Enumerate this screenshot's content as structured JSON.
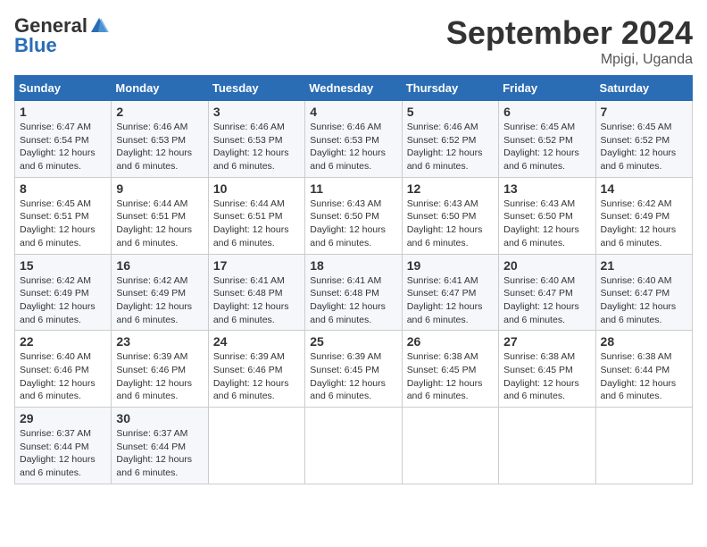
{
  "logo": {
    "general": "General",
    "blue": "Blue"
  },
  "header": {
    "month": "September 2024",
    "location": "Mpigi, Uganda"
  },
  "days_of_week": [
    "Sunday",
    "Monday",
    "Tuesday",
    "Wednesday",
    "Thursday",
    "Friday",
    "Saturday"
  ],
  "weeks": [
    [
      {
        "day": "1",
        "sunrise": "6:47 AM",
        "sunset": "6:54 PM",
        "daylight": "12 hours and 6 minutes."
      },
      {
        "day": "2",
        "sunrise": "6:46 AM",
        "sunset": "6:53 PM",
        "daylight": "12 hours and 6 minutes."
      },
      {
        "day": "3",
        "sunrise": "6:46 AM",
        "sunset": "6:53 PM",
        "daylight": "12 hours and 6 minutes."
      },
      {
        "day": "4",
        "sunrise": "6:46 AM",
        "sunset": "6:53 PM",
        "daylight": "12 hours and 6 minutes."
      },
      {
        "day": "5",
        "sunrise": "6:46 AM",
        "sunset": "6:52 PM",
        "daylight": "12 hours and 6 minutes."
      },
      {
        "day": "6",
        "sunrise": "6:45 AM",
        "sunset": "6:52 PM",
        "daylight": "12 hours and 6 minutes."
      },
      {
        "day": "7",
        "sunrise": "6:45 AM",
        "sunset": "6:52 PM",
        "daylight": "12 hours and 6 minutes."
      }
    ],
    [
      {
        "day": "8",
        "sunrise": "6:45 AM",
        "sunset": "6:51 PM",
        "daylight": "12 hours and 6 minutes."
      },
      {
        "day": "9",
        "sunrise": "6:44 AM",
        "sunset": "6:51 PM",
        "daylight": "12 hours and 6 minutes."
      },
      {
        "day": "10",
        "sunrise": "6:44 AM",
        "sunset": "6:51 PM",
        "daylight": "12 hours and 6 minutes."
      },
      {
        "day": "11",
        "sunrise": "6:43 AM",
        "sunset": "6:50 PM",
        "daylight": "12 hours and 6 minutes."
      },
      {
        "day": "12",
        "sunrise": "6:43 AM",
        "sunset": "6:50 PM",
        "daylight": "12 hours and 6 minutes."
      },
      {
        "day": "13",
        "sunrise": "6:43 AM",
        "sunset": "6:50 PM",
        "daylight": "12 hours and 6 minutes."
      },
      {
        "day": "14",
        "sunrise": "6:42 AM",
        "sunset": "6:49 PM",
        "daylight": "12 hours and 6 minutes."
      }
    ],
    [
      {
        "day": "15",
        "sunrise": "6:42 AM",
        "sunset": "6:49 PM",
        "daylight": "12 hours and 6 minutes."
      },
      {
        "day": "16",
        "sunrise": "6:42 AM",
        "sunset": "6:49 PM",
        "daylight": "12 hours and 6 minutes."
      },
      {
        "day": "17",
        "sunrise": "6:41 AM",
        "sunset": "6:48 PM",
        "daylight": "12 hours and 6 minutes."
      },
      {
        "day": "18",
        "sunrise": "6:41 AM",
        "sunset": "6:48 PM",
        "daylight": "12 hours and 6 minutes."
      },
      {
        "day": "19",
        "sunrise": "6:41 AM",
        "sunset": "6:47 PM",
        "daylight": "12 hours and 6 minutes."
      },
      {
        "day": "20",
        "sunrise": "6:40 AM",
        "sunset": "6:47 PM",
        "daylight": "12 hours and 6 minutes."
      },
      {
        "day": "21",
        "sunrise": "6:40 AM",
        "sunset": "6:47 PM",
        "daylight": "12 hours and 6 minutes."
      }
    ],
    [
      {
        "day": "22",
        "sunrise": "6:40 AM",
        "sunset": "6:46 PM",
        "daylight": "12 hours and 6 minutes."
      },
      {
        "day": "23",
        "sunrise": "6:39 AM",
        "sunset": "6:46 PM",
        "daylight": "12 hours and 6 minutes."
      },
      {
        "day": "24",
        "sunrise": "6:39 AM",
        "sunset": "6:46 PM",
        "daylight": "12 hours and 6 minutes."
      },
      {
        "day": "25",
        "sunrise": "6:39 AM",
        "sunset": "6:45 PM",
        "daylight": "12 hours and 6 minutes."
      },
      {
        "day": "26",
        "sunrise": "6:38 AM",
        "sunset": "6:45 PM",
        "daylight": "12 hours and 6 minutes."
      },
      {
        "day": "27",
        "sunrise": "6:38 AM",
        "sunset": "6:45 PM",
        "daylight": "12 hours and 6 minutes."
      },
      {
        "day": "28",
        "sunrise": "6:38 AM",
        "sunset": "6:44 PM",
        "daylight": "12 hours and 6 minutes."
      }
    ],
    [
      {
        "day": "29",
        "sunrise": "6:37 AM",
        "sunset": "6:44 PM",
        "daylight": "12 hours and 6 minutes."
      },
      {
        "day": "30",
        "sunrise": "6:37 AM",
        "sunset": "6:44 PM",
        "daylight": "12 hours and 6 minutes."
      },
      null,
      null,
      null,
      null,
      null
    ]
  ],
  "labels": {
    "sunrise": "Sunrise:",
    "sunset": "Sunset:",
    "daylight": "Daylight:"
  }
}
